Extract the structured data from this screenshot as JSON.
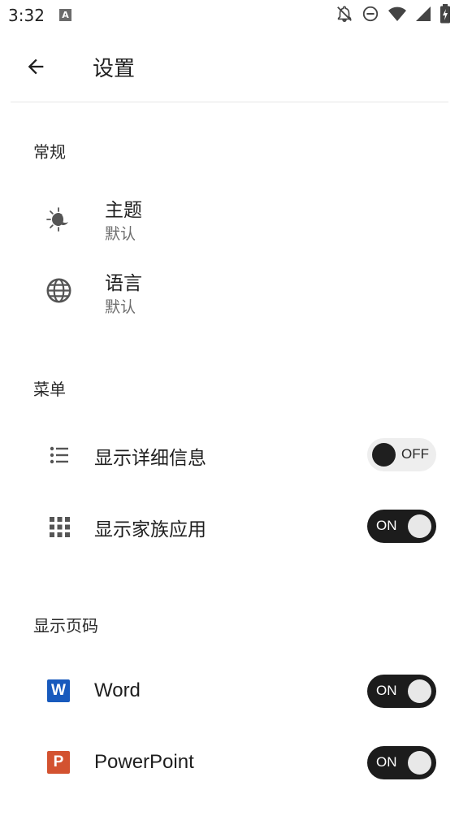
{
  "status_bar": {
    "time": "3:32",
    "notification_letter": "A",
    "icons": [
      "notifications-off-icon",
      "do-not-disturb-icon",
      "wifi-icon",
      "cellular-signal-icon",
      "battery-charging-icon"
    ]
  },
  "app_bar": {
    "title": "设置",
    "back_icon": "arrow-back-icon"
  },
  "sections": {
    "general": {
      "header": "常规",
      "theme": {
        "title": "主题",
        "value": "默认",
        "icon": "theme-icon"
      },
      "language": {
        "title": "语言",
        "value": "默认",
        "icon": "globe-icon"
      }
    },
    "menu": {
      "header": "菜单",
      "show_details": {
        "title": "显示详细信息",
        "toggle": "OFF",
        "icon": "list-icon"
      },
      "show_family_apps": {
        "title": "显示家族应用",
        "toggle": "ON",
        "icon": "apps-grid-icon"
      }
    },
    "page_numbers": {
      "header": "显示页码",
      "word": {
        "title": "Word",
        "badge": "W",
        "toggle": "ON",
        "color": "#185abd"
      },
      "powerpoint": {
        "title": "PowerPoint",
        "badge": "P",
        "toggle": "ON",
        "color": "#d35230"
      }
    }
  }
}
